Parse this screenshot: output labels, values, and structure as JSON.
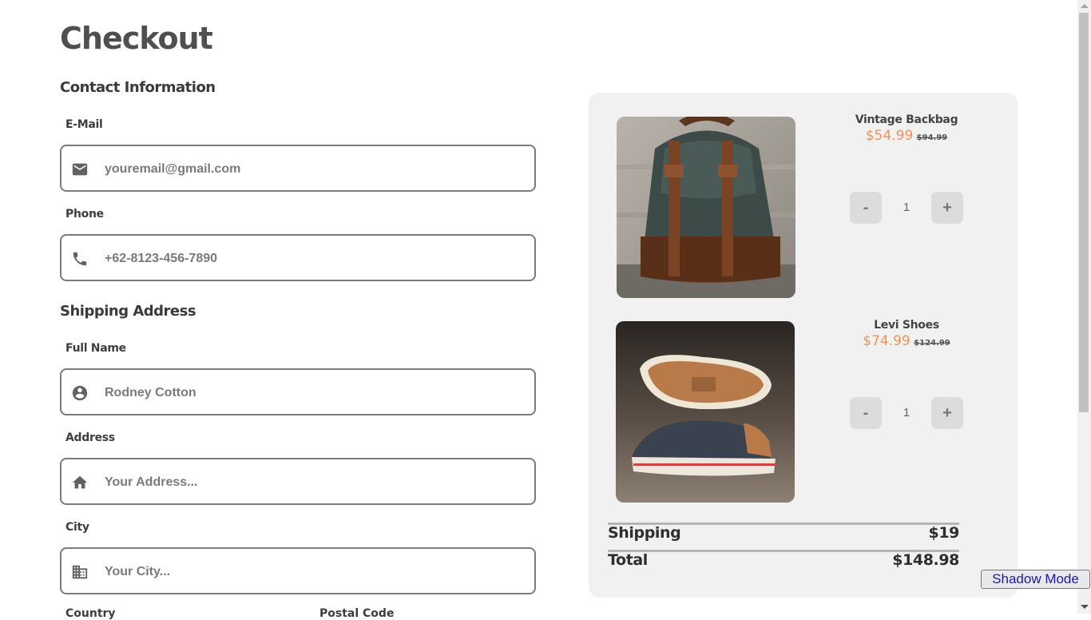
{
  "page": {
    "title": "Checkout"
  },
  "contact": {
    "heading": "Contact Information",
    "email_label": "E-Mail",
    "email_placeholder": "youremail@gmail.com",
    "phone_label": "Phone",
    "phone_placeholder": "+62-8123-456-7890"
  },
  "shipping": {
    "heading": "Shipping Address",
    "fullname_label": "Full Name",
    "fullname_placeholder": "Rodney Cotton",
    "address_label": "Address",
    "address_placeholder": "Your Address...",
    "city_label": "City",
    "city_placeholder": "Your City...",
    "country_label": "Country",
    "postal_label": "Postal Code"
  },
  "cart": {
    "items": [
      {
        "name": "Vintage Backbag",
        "price": "$54.99",
        "old_price": "$94.99",
        "qty": "1"
      },
      {
        "name": "Levi Shoes",
        "price": "$74.99",
        "old_price": "$124.99",
        "qty": "1"
      }
    ],
    "minus_label": "-",
    "plus_label": "+",
    "shipping_label": "Shipping",
    "shipping_value": "$19",
    "total_label": "Total",
    "total_value": "$148.98"
  },
  "controls": {
    "shadow_mode": "Shadow Mode"
  },
  "colors": {
    "accent_price": "#f0935a",
    "panel": "#f1f1f1",
    "border": "#7b7b7b"
  },
  "icons": {
    "email": "envelope-icon",
    "phone": "phone-icon",
    "name": "account-circle-icon",
    "address": "home-icon",
    "city": "building-icon"
  }
}
